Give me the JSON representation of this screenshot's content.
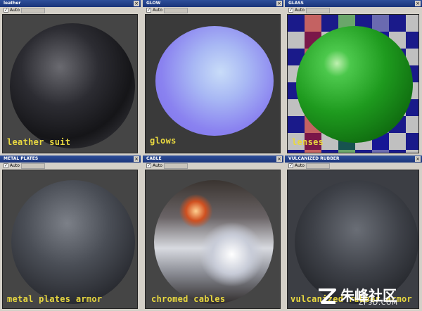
{
  "panels": [
    {
      "title": "leather",
      "auto": "Auto",
      "caption": "leather suit"
    },
    {
      "title": "GLOW",
      "auto": "Auto",
      "caption": "glows"
    },
    {
      "title": "GLASS",
      "auto": "Auto",
      "caption": "lenses"
    },
    {
      "title": "METAL PLATES",
      "auto": "Auto",
      "caption": "metal plates armor"
    },
    {
      "title": "CABLE",
      "auto": "Auto",
      "caption": "chromed cables"
    },
    {
      "title": "VULCANIZED RUBBER",
      "auto": "Auto",
      "caption": "vulcanized rubber armor"
    }
  ],
  "watermark": {
    "text": "朱峰社区",
    "sub": "ZF3D.COM"
  },
  "colors": {
    "titlebar": "#1f3d8a",
    "caption": "#e8d840",
    "viewport": "#454545"
  }
}
